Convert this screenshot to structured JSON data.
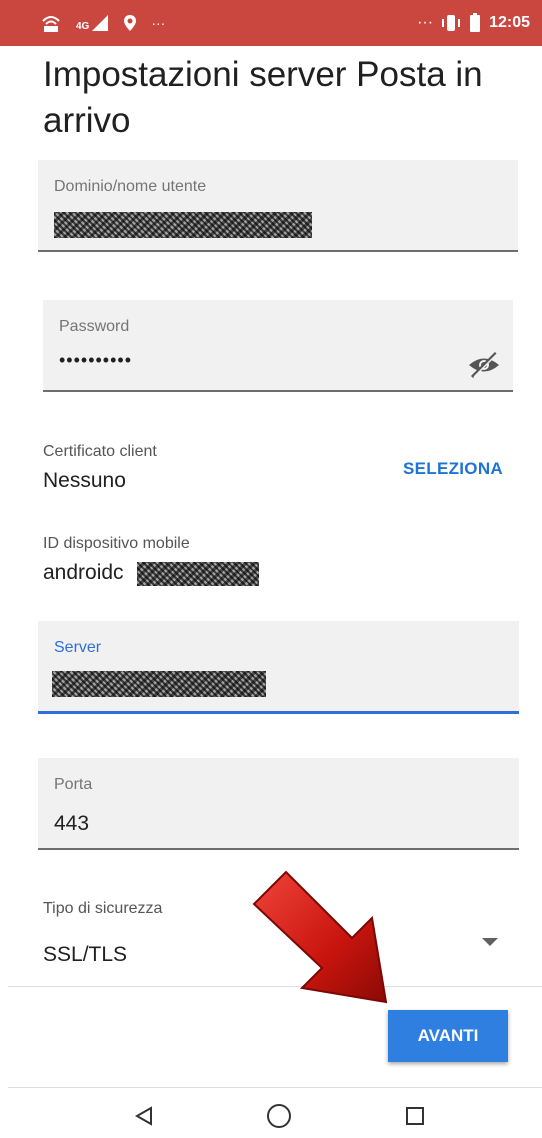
{
  "status_bar": {
    "left_icons": [
      "vowifi-icon",
      "signal-4g-icon",
      "location-icon",
      "more-icon"
    ],
    "signal_label": "4G",
    "dots": "···",
    "time": "12:05"
  },
  "page": {
    "title": "Impostazioni server Posta in arrivo"
  },
  "fields": {
    "domain_username": {
      "label": "Dominio/nome utente",
      "value": ""
    },
    "password": {
      "label": "Password",
      "value": "••••••••••",
      "toggle_icon": "visibility-off-icon"
    },
    "client_cert": {
      "label": "Certificato client",
      "value": "Nessuno",
      "action": "SELEZIONA"
    },
    "device_id": {
      "label": "ID dispositivo mobile",
      "value": "androidc"
    },
    "server": {
      "label": "Server",
      "value": ""
    },
    "port": {
      "label": "Porta",
      "value": "443"
    },
    "security": {
      "label": "Tipo di sicurezza",
      "value": "SSL/TLS"
    }
  },
  "actions": {
    "next_label": "AVANTI"
  },
  "nav": {
    "icons": [
      "back-icon",
      "home-icon",
      "recents-icon"
    ]
  },
  "colors": {
    "status_bar": "#c9473f",
    "accent": "#2e7fe0",
    "arrow": "#d01a12"
  }
}
